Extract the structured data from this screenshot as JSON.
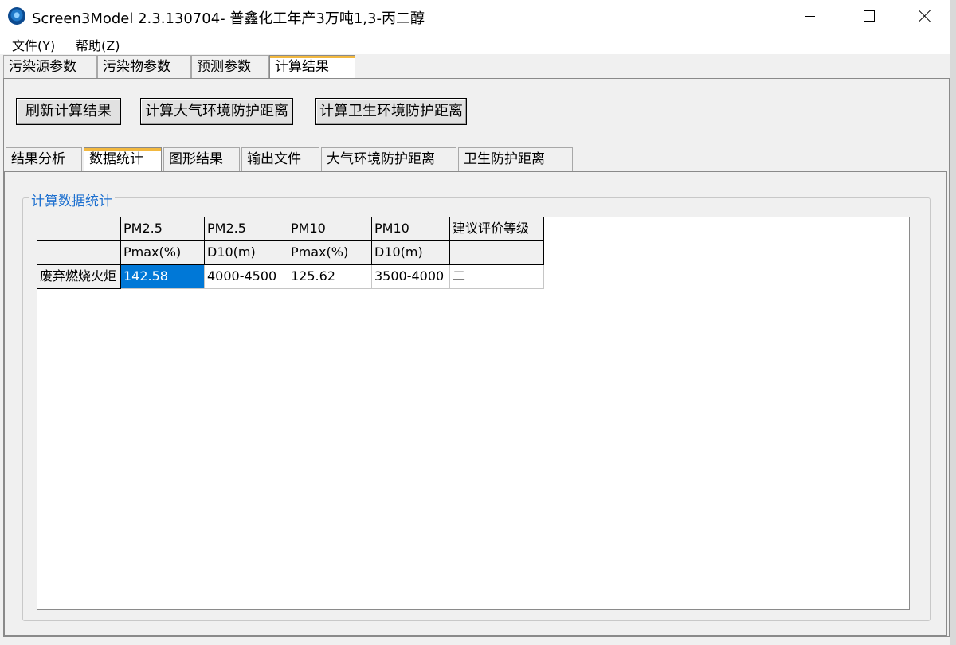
{
  "window": {
    "title": "Screen3Model 2.3.130704- 普鑫化工年产3万吨1,3-丙二醇"
  },
  "menu": {
    "file": "文件(Y)",
    "help": "帮助(Z)"
  },
  "tabs": [
    {
      "label": "污染源参数"
    },
    {
      "label": "污染物参数"
    },
    {
      "label": "预测参数"
    },
    {
      "label": "计算结果",
      "active": true
    }
  ],
  "actions": {
    "refresh": "刷新计算结果",
    "calc_air": "计算大气环境防护距离",
    "calc_health": "计算卫生环境防护距离"
  },
  "subtabs": [
    {
      "label": "结果分析"
    },
    {
      "label": "数据统计",
      "active": true
    },
    {
      "label": "图形结果"
    },
    {
      "label": "输出文件"
    },
    {
      "label": "大气环境防护距离"
    },
    {
      "label": "卫生防护距离"
    }
  ],
  "group": {
    "title": "计算数据统计"
  },
  "grid": {
    "header_row1": [
      "",
      "PM2.5",
      "PM2.5",
      "PM10",
      "PM10",
      "建议评价等级"
    ],
    "header_row2": [
      "",
      "Pmax(%)",
      "D10(m)",
      "Pmax(%)",
      "D10(m)",
      ""
    ],
    "rows": [
      [
        "废弃燃烧火炬",
        "142.58",
        "4000-4500",
        "125.62",
        "3500-4000",
        "二"
      ]
    ]
  },
  "colors": {
    "active_tab_accent": "#f2b83f",
    "group_title": "#1c6fcf",
    "selection": "#0078d7"
  }
}
